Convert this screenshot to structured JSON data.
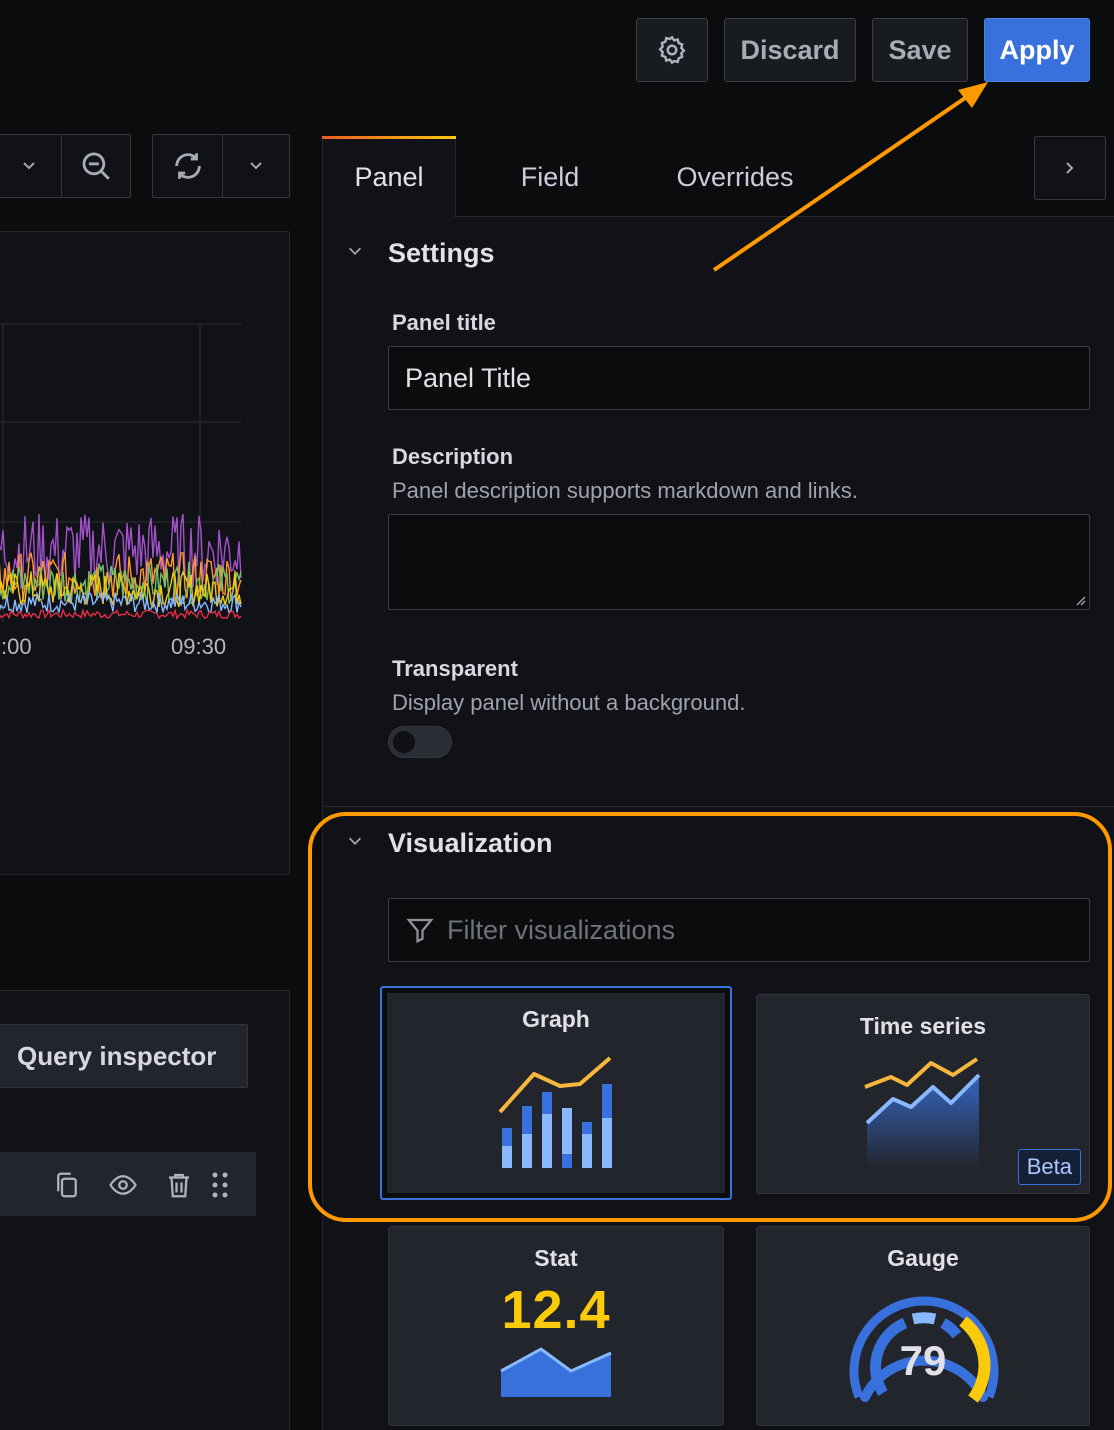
{
  "toolbar": {
    "settings_icon": "gear-icon",
    "discard_label": "Discard",
    "save_label": "Save",
    "apply_label": "Apply"
  },
  "left": {
    "zoom_icon": "zoom-out-icon",
    "refresh_icon": "refresh-icon",
    "x_ticks": [
      ":00",
      "09:30"
    ],
    "query_inspector_label": "Query inspector",
    "row_icons": [
      "duplicate-icon",
      "eye-icon",
      "trash-icon",
      "drag-handle-icon"
    ]
  },
  "tabs": [
    {
      "label": "Panel",
      "active": true
    },
    {
      "label": "Field",
      "active": false
    },
    {
      "label": "Overrides",
      "active": false
    }
  ],
  "settings": {
    "heading": "Settings",
    "panel_title_label": "Panel title",
    "panel_title_value": "Panel Title",
    "description_label": "Description",
    "description_help": "Panel description supports markdown and links.",
    "description_value": "",
    "transparent_label": "Transparent",
    "transparent_help": "Display panel without a background.",
    "transparent_on": false
  },
  "visualization": {
    "heading": "Visualization",
    "filter_placeholder": "Filter visualizations",
    "cards": [
      {
        "title": "Graph",
        "selected": true
      },
      {
        "title": "Time series",
        "badge": "Beta"
      },
      {
        "title": "Stat",
        "value": "12.4"
      },
      {
        "title": "Gauge",
        "value": "79"
      }
    ]
  },
  "colors": {
    "accent": "#3871dc",
    "highlight": "#ff9900",
    "background": "#0b0c0e",
    "panel": "#111217"
  }
}
